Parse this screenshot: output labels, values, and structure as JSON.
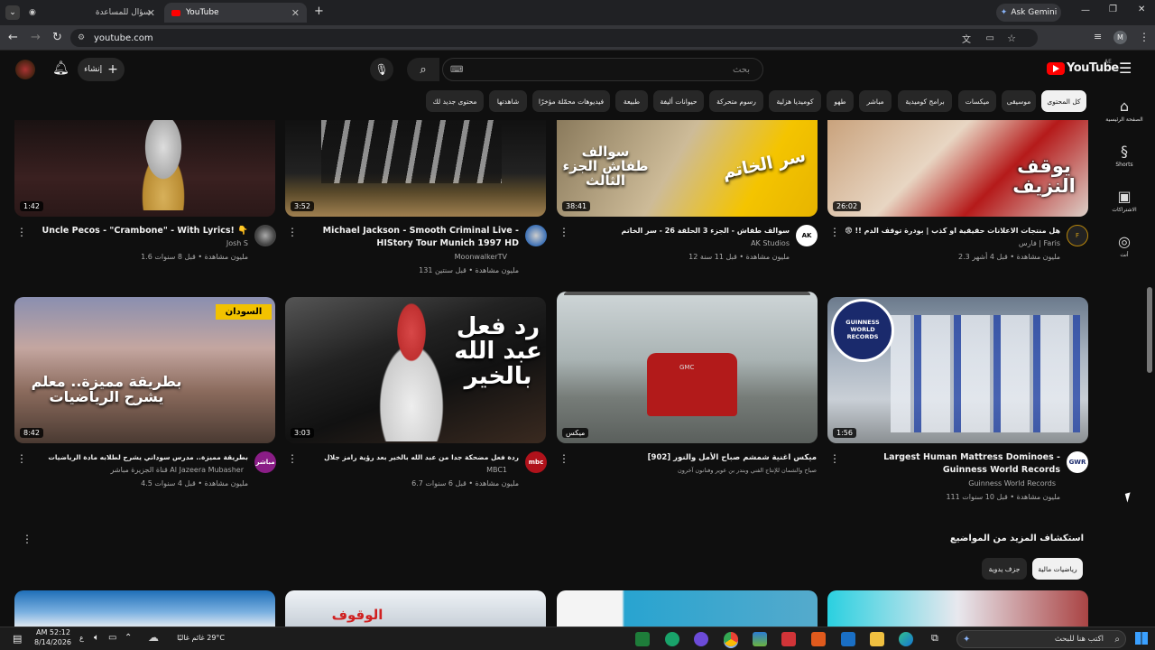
{
  "browser": {
    "tabs": [
      {
        "title": "سؤال للمساعدة"
      },
      {
        "title": "YouTube"
      }
    ],
    "new_tab": "+",
    "ask_gemini": "Ask Gemini",
    "url": "youtube.com",
    "profile_initial": "M"
  },
  "header": {
    "logo_text": "YouTube",
    "region": "AE",
    "search_placeholder": "بحث",
    "create_label": "إنشاء"
  },
  "chips": [
    "كل المحتوى",
    "موسيقى",
    "ميكسات",
    "برامج كوميدية",
    "مباشر",
    "طهو",
    "كوميديا هزلية",
    "رسوم متحركة",
    "حيوانات أليفة",
    "طبيعة",
    "فيديوهات محمّلة مؤخرًا",
    "شاهدتها",
    "محتوى جديد لك"
  ],
  "rail": [
    {
      "icon": "home-icon",
      "label": "الصفحة الرئيسية"
    },
    {
      "icon": "shorts-icon",
      "label": "Shorts"
    },
    {
      "icon": "subscriptions-icon",
      "label": "الاشتراكات"
    },
    {
      "icon": "you-icon",
      "label": "أنت"
    }
  ],
  "row1": [
    {
      "duration": "26:02",
      "title": "هل منتجات الاعلانات حقيقية او كذب | بودرة توقف الدم !! 😨 )",
      "channel": "فارس | Faris",
      "meta": "2.3 مليون مشاهدة • قبل 4 أشهر",
      "thumb_text": "يوقف النزيف"
    },
    {
      "duration": "38:41",
      "title": "سوالف طفاش - الجزء 3 الحلقة 26 - سر الخاتم",
      "channel": "AK Studios",
      "meta": "12 مليون مشاهدة • قبل 11 سنة",
      "thumb_text": "سوالف طفاش الجزء الثالث",
      "thumb_text2": "سر الخاتم",
      "avatar_text": "AK"
    },
    {
      "duration": "3:52",
      "title": "Michael Jackson - Smooth Criminal Live - HIStory Tour Munich 1997 HD",
      "channel": "MoonwalkerTV",
      "meta": "131 مليون مشاهدة • قبل سنتين"
    },
    {
      "duration": "1:42",
      "title": "Uncle Pecos - \"Crambone\" - With Lyrics! 👇",
      "channel": "Josh S",
      "meta": "1.6 مليون مشاهدة • قبل 8 سنوات"
    }
  ],
  "row2": [
    {
      "duration": "1:56",
      "title": "Largest Human Mattress Dominoes - Guinness World Records",
      "channel": "Guinness World Records",
      "meta": "111 مليون مشاهدة • قبل 10 سنوات",
      "thumb_text": "GUINNESS WORLD RECORDS"
    },
    {
      "duration": "ميكس",
      "title": "ميكس اغنية شمشم صباح الأمل والنور [902]",
      "channel": "صباح والشمان للإنتاج الفني وبندر بن عوير وفنانون آخرون",
      "meta": "",
      "thumb_text": "GMC"
    },
    {
      "duration": "3:03",
      "title": "ردة فعل مضحكة جدا من عبد الله بالخير بعد رؤية رامز جلال",
      "channel": "MBC1",
      "meta": "6.7 مليون مشاهدة • قبل 6 سنوات",
      "thumb_text": "رد فعل عبد الله بالخير",
      "avatar_text": "mbc"
    },
    {
      "duration": "8:42",
      "title": "بطريقة مميزة.. مدرس سوداني يشرح لطلابه مادة الرياضيات",
      "channel": "قناة الجزيرة مباشر Al Jazeera Mubasher",
      "meta": "4.5 مليون مشاهدة • قبل 4 سنوات",
      "thumb_badge": "السودان",
      "thumb_text": "بطريقة مميزة.. معلم يشرح الرياضيات",
      "avatar_text": "مباشر"
    }
  ],
  "explore": {
    "title": "استكشاف المزيد من المواضيع",
    "chips": [
      "رياضيات مالية",
      "جزف يدوية"
    ]
  },
  "row3": [
    {
      "thumb_text": ""
    },
    {
      "thumb_text": ""
    },
    {
      "thumb_text": "الوقوف"
    },
    {
      "thumb_text": ""
    }
  ],
  "taskbar": {
    "search_placeholder": "اكتب هنا للبحث",
    "weather": "29°C غائم غالبًا",
    "time": "AM 52:12",
    "date": "8/14/2026",
    "lang": "ع"
  },
  "colors": {
    "yt_red": "#ff0000",
    "bg": "#0f0f0f",
    "chip_bg": "#272727"
  }
}
